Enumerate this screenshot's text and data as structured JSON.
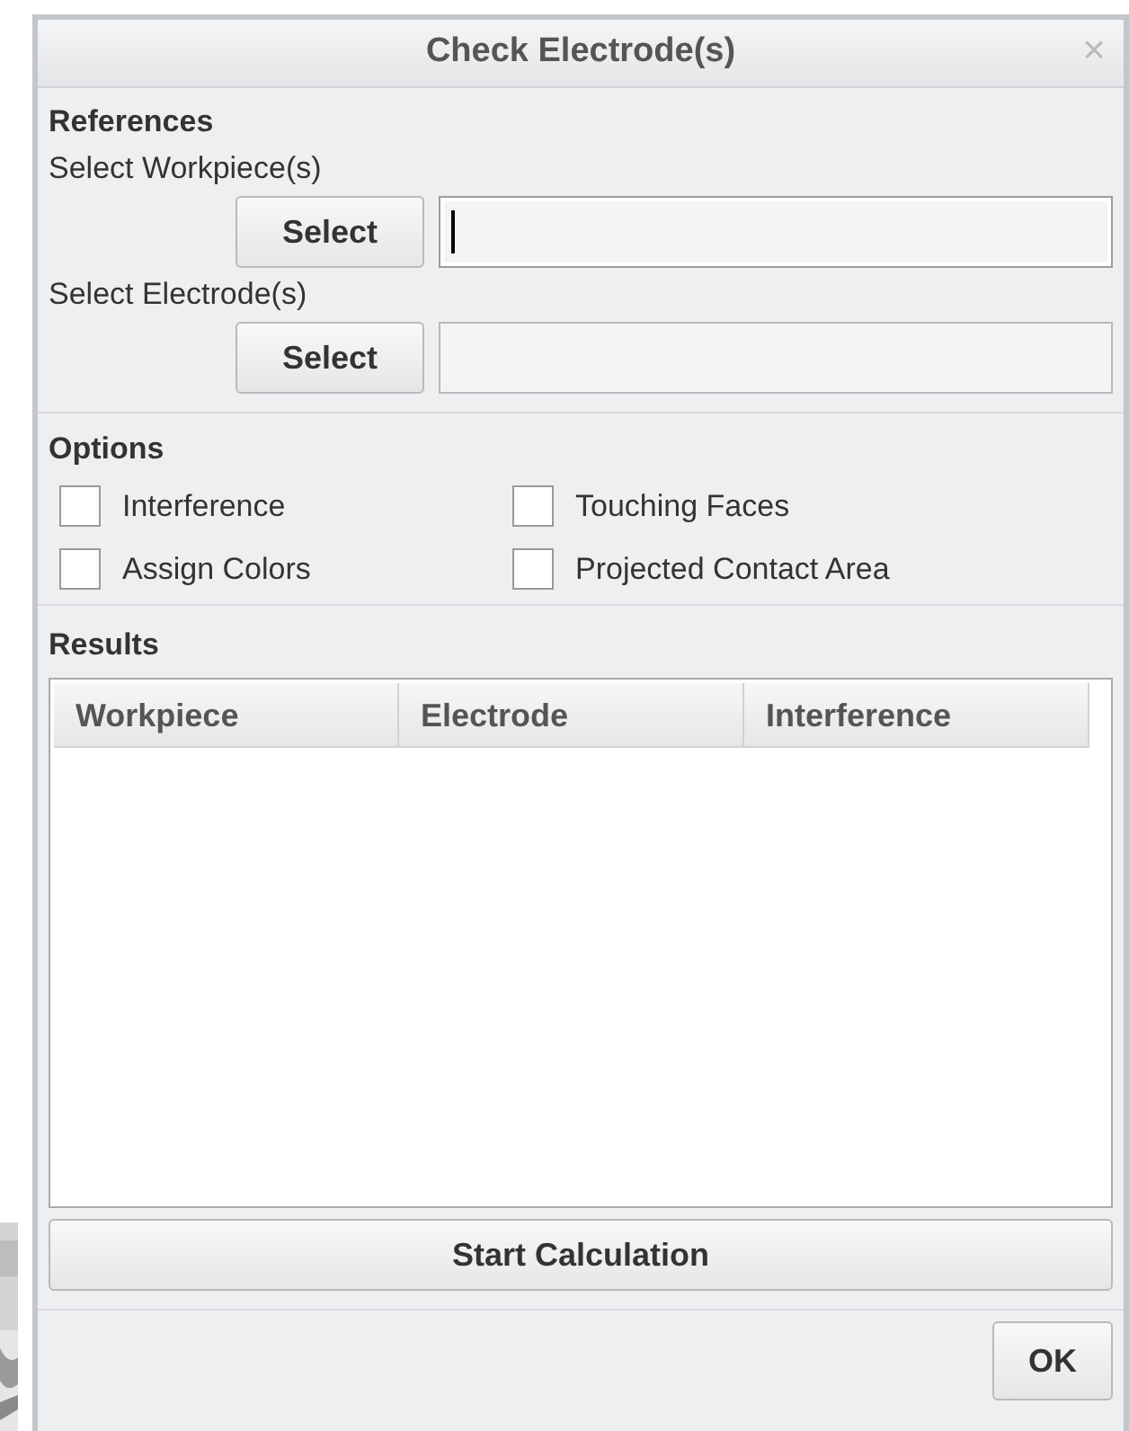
{
  "dialog": {
    "title": "Check Electrode(s)",
    "close": "×"
  },
  "references": {
    "heading": "References",
    "rows": [
      {
        "label": "Select Workpiece(s)",
        "button": "Select",
        "focused": true
      },
      {
        "label": "Select Electrode(s)",
        "button": "Select",
        "focused": false
      }
    ]
  },
  "options": {
    "heading": "Options",
    "items": [
      {
        "label": "Interference",
        "checked": false
      },
      {
        "label": "Touching Faces",
        "checked": false
      },
      {
        "label": "Assign Colors",
        "checked": false
      },
      {
        "label": "Projected Contact Area",
        "checked": false
      }
    ]
  },
  "results": {
    "heading": "Results",
    "columns": [
      "Workpiece",
      "Electrode",
      "Interference"
    ]
  },
  "start_button": "Start Calculation",
  "ok_button": "OK"
}
